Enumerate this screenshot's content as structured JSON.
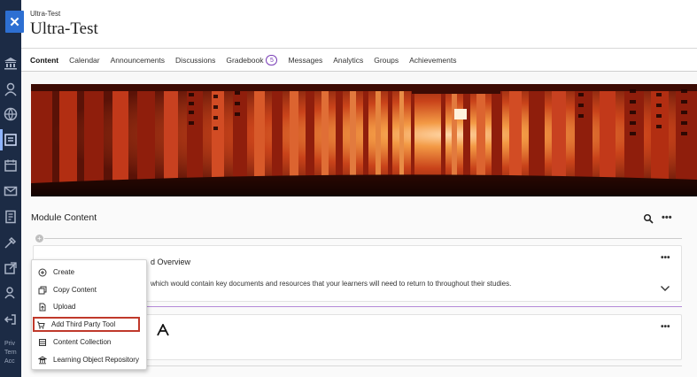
{
  "course": {
    "small_title": "Ultra-Test",
    "title": "Ultra-Test"
  },
  "close_label": "✕",
  "leftnav": {
    "footer_lines": [
      "Priv",
      "Tern",
      "Acc"
    ]
  },
  "tabs": [
    {
      "label": "Content",
      "active": true
    },
    {
      "label": "Calendar"
    },
    {
      "label": "Announcements"
    },
    {
      "label": "Discussions"
    },
    {
      "label": "Gradebook",
      "badge": "5"
    },
    {
      "label": "Messages"
    },
    {
      "label": "Analytics"
    },
    {
      "label": "Groups"
    },
    {
      "label": "Achievements"
    }
  ],
  "module": {
    "title": "Module Content",
    "more": "•••"
  },
  "cards": [
    {
      "title": "d Overview",
      "description": "which would contain key documents and resources that your learners will need to return to throughout their studies.",
      "more": "•••"
    },
    {
      "more": "•••"
    }
  ],
  "menu": {
    "items": [
      {
        "label": "Create",
        "icon": "plus-circle-icon"
      },
      {
        "label": "Copy Content",
        "icon": "copy-icon"
      },
      {
        "label": "Upload",
        "icon": "upload-icon"
      },
      {
        "label": "Add Third Party Tool",
        "icon": "cart-icon",
        "highlighted": true
      },
      {
        "label": "Content Collection",
        "icon": "collection-icon"
      },
      {
        "label": "Learning Object Repository",
        "icon": "repository-icon"
      }
    ]
  },
  "colors": {
    "nav_bg": "#1c2b45",
    "accent": "#6b2fa8",
    "close_button": "#2d6fd2",
    "highlight_border": "#c0392b"
  }
}
